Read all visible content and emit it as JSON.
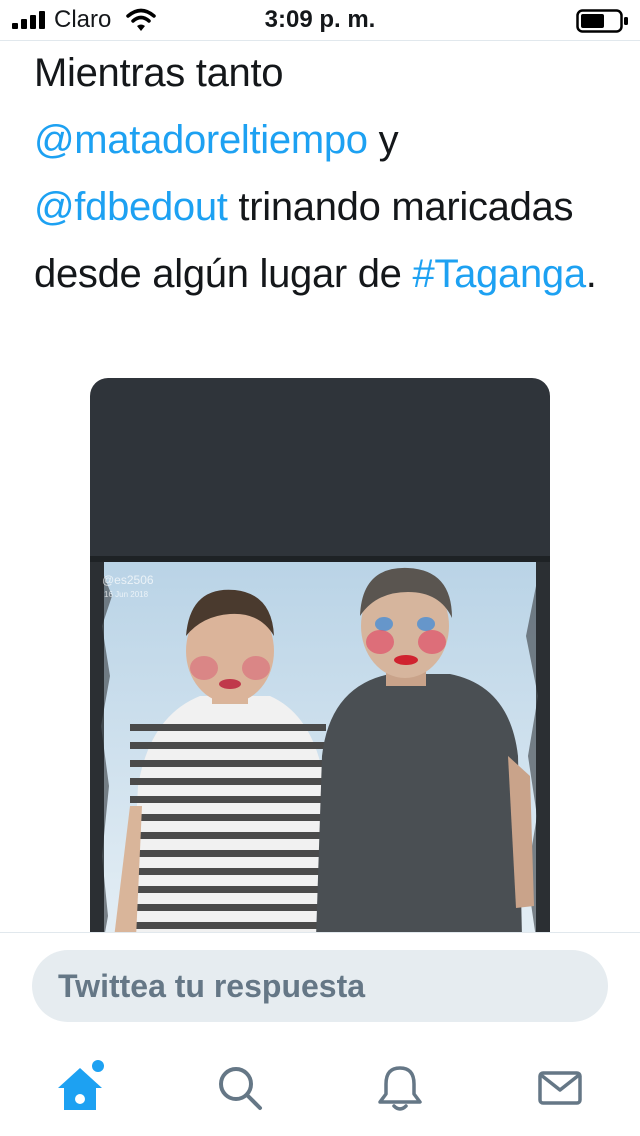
{
  "status_bar": {
    "carrier": "Claro",
    "time": "3:09 p. m.",
    "icons": [
      "signal-bars-icon",
      "wifi-icon",
      "battery-icon"
    ]
  },
  "tweet": {
    "text_parts": {
      "p1": "Mientras tanto",
      "mention1": "@matadoreltiempo",
      "p2": " y",
      "mention2": "@fdbedout",
      "p3": " trinando maricadas desde algún lugar de ",
      "hashtag": "#Taganga",
      "p4": "."
    },
    "image": {
      "watermark": "@es2506",
      "watermark_date": "16 Jun 2018"
    }
  },
  "reply": {
    "placeholder": "Twittea tu respuesta"
  },
  "tab_bar": {
    "items": [
      "home-icon",
      "search-icon",
      "notifications-bell-icon",
      "messages-envelope-icon"
    ],
    "active": "home-icon"
  },
  "colors": {
    "link": "#1da1f2",
    "text": "#14171a",
    "input_bg": "#e6ecf0",
    "placeholder": "#657786",
    "media_bg": "#2f343a"
  }
}
